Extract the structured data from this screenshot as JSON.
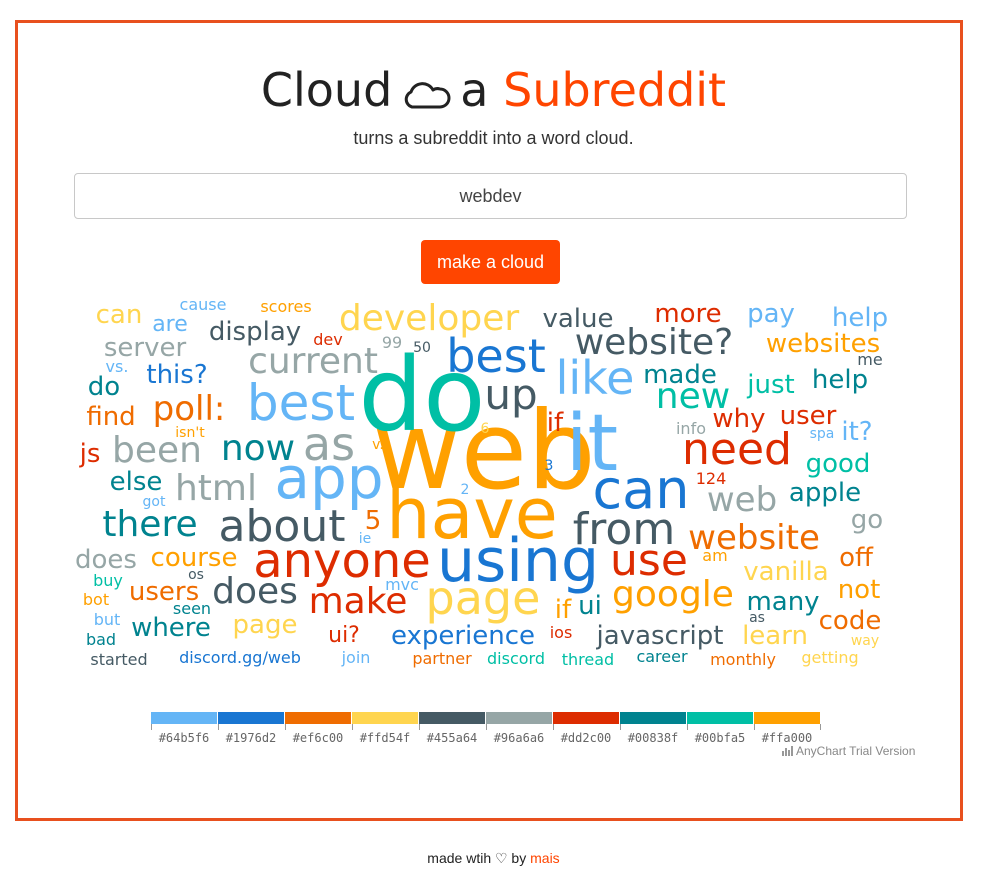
{
  "header": {
    "title_part1": "Cloud",
    "title_part2": "a",
    "title_accent": "Subreddit",
    "subtitle": "turns a subreddit into a word cloud."
  },
  "search": {
    "value": "webdev"
  },
  "make_button": {
    "label": "make a cloud"
  },
  "colors": {
    "accent": "#ff4500"
  },
  "cloud_words": [
    {
      "t": "web",
      "c": "#ffa000"
    },
    {
      "t": "do",
      "c": "#00bfa5"
    },
    {
      "t": "it",
      "c": "#64b5f6"
    },
    {
      "t": "have",
      "c": "#ffa000"
    },
    {
      "t": "using",
      "c": "#1976d2"
    },
    {
      "t": "can",
      "c": "#1976d2"
    },
    {
      "t": "anyone",
      "c": "#dd2c00"
    },
    {
      "t": "app",
      "c": "#64b5f6"
    },
    {
      "t": "from",
      "c": "#455a64"
    },
    {
      "t": "best",
      "c": "#64b5f6"
    },
    {
      "t": "about",
      "c": "#455a64"
    },
    {
      "t": "page",
      "c": "#ffd54f"
    },
    {
      "t": "need",
      "c": "#dd2c00"
    },
    {
      "t": "best",
      "c": "#1976d2"
    },
    {
      "t": "like",
      "c": "#64b5f6"
    },
    {
      "t": "use",
      "c": "#dd2c00"
    },
    {
      "t": "website?",
      "c": "#455a64"
    },
    {
      "t": "developer",
      "c": "#ffd54f"
    },
    {
      "t": "up",
      "c": "#455a64"
    },
    {
      "t": "as",
      "c": "#96a6a6"
    },
    {
      "t": "current",
      "c": "#96a6a6"
    },
    {
      "t": "google",
      "c": "#ffa000"
    },
    {
      "t": "website",
      "c": "#ef6c00"
    },
    {
      "t": "does",
      "c": "#455a64"
    },
    {
      "t": "been",
      "c": "#96a6a6"
    },
    {
      "t": "make",
      "c": "#dd2c00"
    },
    {
      "t": "now",
      "c": "#00838f"
    },
    {
      "t": "html",
      "c": "#96a6a6"
    },
    {
      "t": "there",
      "c": "#00838f"
    },
    {
      "t": "new",
      "c": "#00bfa5"
    },
    {
      "t": "web",
      "c": "#96a6a6"
    },
    {
      "t": "poll:",
      "c": "#ef6c00"
    },
    {
      "t": "display",
      "c": "#455a64"
    },
    {
      "t": "value",
      "c": "#455a64"
    },
    {
      "t": "more",
      "c": "#dd2c00"
    },
    {
      "t": "pay",
      "c": "#64b5f6"
    },
    {
      "t": "help",
      "c": "#64b5f6"
    },
    {
      "t": "websites",
      "c": "#ffa000"
    },
    {
      "t": "help",
      "c": "#00838f"
    },
    {
      "t": "just",
      "c": "#00bfa5"
    },
    {
      "t": "made",
      "c": "#00838f"
    },
    {
      "t": "why",
      "c": "#dd2c00"
    },
    {
      "t": "user",
      "c": "#dd2c00"
    },
    {
      "t": "it?",
      "c": "#64b5f6"
    },
    {
      "t": "good",
      "c": "#00bfa5"
    },
    {
      "t": "apple",
      "c": "#00838f"
    },
    {
      "t": "go",
      "c": "#96a6a6"
    },
    {
      "t": "off",
      "c": "#ef6c00"
    },
    {
      "t": "not",
      "c": "#ffa000"
    },
    {
      "t": "code",
      "c": "#ef6c00"
    },
    {
      "t": "vanilla",
      "c": "#ffd54f"
    },
    {
      "t": "many",
      "c": "#00838f"
    },
    {
      "t": "learn",
      "c": "#ffd54f"
    },
    {
      "t": "javascript",
      "c": "#455a64"
    },
    {
      "t": "experience",
      "c": "#1976d2"
    },
    {
      "t": "where",
      "c": "#00838f"
    },
    {
      "t": "users",
      "c": "#ef6c00"
    },
    {
      "t": "course",
      "c": "#ffa000"
    },
    {
      "t": "does",
      "c": "#96a6a6"
    },
    {
      "t": "else",
      "c": "#00838f"
    },
    {
      "t": "js",
      "c": "#dd2c00"
    },
    {
      "t": "find",
      "c": "#ef6c00"
    },
    {
      "t": "do",
      "c": "#00838f"
    },
    {
      "t": "this?",
      "c": "#1976d2"
    },
    {
      "t": "server",
      "c": "#96a6a6"
    },
    {
      "t": "can",
      "c": "#ffd54f"
    },
    {
      "t": "are",
      "c": "#64b5f6"
    },
    {
      "t": "cause",
      "c": "#64b5f6"
    },
    {
      "t": "scores",
      "c": "#ffa000"
    },
    {
      "t": "dev",
      "c": "#dd2c00"
    },
    {
      "t": "99",
      "c": "#96a6a6"
    },
    {
      "t": "50",
      "c": "#455a64"
    },
    {
      "t": "me",
      "c": "#455a64"
    },
    {
      "t": "vs.",
      "c": "#64b5f6"
    },
    {
      "t": "isn't",
      "c": "#ffa000"
    },
    {
      "t": "v.",
      "c": "#ffa000"
    },
    {
      "t": "6",
      "c": "#ffd54f"
    },
    {
      "t": "if",
      "c": "#dd2c00"
    },
    {
      "t": "3",
      "c": "#1976d2"
    },
    {
      "t": "2",
      "c": "#64b5f6"
    },
    {
      "t": "info",
      "c": "#96a6a6"
    },
    {
      "t": "spa",
      "c": "#64b5f6"
    },
    {
      "t": "124",
      "c": "#dd2c00"
    },
    {
      "t": "got",
      "c": "#64b5f6"
    },
    {
      "t": "5",
      "c": "#ef6c00"
    },
    {
      "t": "ie",
      "c": "#64b5f6"
    },
    {
      "t": "am",
      "c": "#ffa000"
    },
    {
      "t": "os",
      "c": "#455a64"
    },
    {
      "t": "buy",
      "c": "#00bfa5"
    },
    {
      "t": "bot",
      "c": "#ffa000"
    },
    {
      "t": "but",
      "c": "#64b5f6"
    },
    {
      "t": "seen",
      "c": "#00838f"
    },
    {
      "t": "bad",
      "c": "#00838f"
    },
    {
      "t": "started",
      "c": "#455a64"
    },
    {
      "t": "discord.gg/web",
      "c": "#1976d2"
    },
    {
      "t": "join",
      "c": "#64b5f6"
    },
    {
      "t": "partner",
      "c": "#ef6c00"
    },
    {
      "t": "discord",
      "c": "#00bfa5"
    },
    {
      "t": "thread",
      "c": "#00bfa5"
    },
    {
      "t": "career",
      "c": "#00838f"
    },
    {
      "t": "monthly",
      "c": "#ef6c00"
    },
    {
      "t": "getting",
      "c": "#ffd54f"
    },
    {
      "t": "way",
      "c": "#ffd54f"
    },
    {
      "t": "as",
      "c": "#455a64"
    },
    {
      "t": "page",
      "c": "#ffd54f"
    },
    {
      "t": "ui?",
      "c": "#dd2c00"
    },
    {
      "t": "mvc",
      "c": "#64b5f6"
    },
    {
      "t": "if",
      "c": "#ffa000"
    },
    {
      "t": "ui",
      "c": "#00838f"
    },
    {
      "t": "ios",
      "c": "#dd2c00"
    }
  ],
  "legend": [
    {
      "label": "#64b5f6",
      "color": "#64b5f6"
    },
    {
      "label": "#1976d2",
      "color": "#1976d2"
    },
    {
      "label": "#ef6c00",
      "color": "#ef6c00"
    },
    {
      "label": "#ffd54f",
      "color": "#ffd54f"
    },
    {
      "label": "#455a64",
      "color": "#455a64"
    },
    {
      "label": "#96a6a6",
      "color": "#96a6a6"
    },
    {
      "label": "#dd2c00",
      "color": "#dd2c00"
    },
    {
      "label": "#00838f",
      "color": "#00838f"
    },
    {
      "label": "#00bfa5",
      "color": "#00bfa5"
    },
    {
      "label": "#ffa000",
      "color": "#ffa000"
    }
  ],
  "trial_text": "AnyChart Trial Version",
  "footer": {
    "text": "made wtih ♡ by",
    "link": "mais"
  }
}
